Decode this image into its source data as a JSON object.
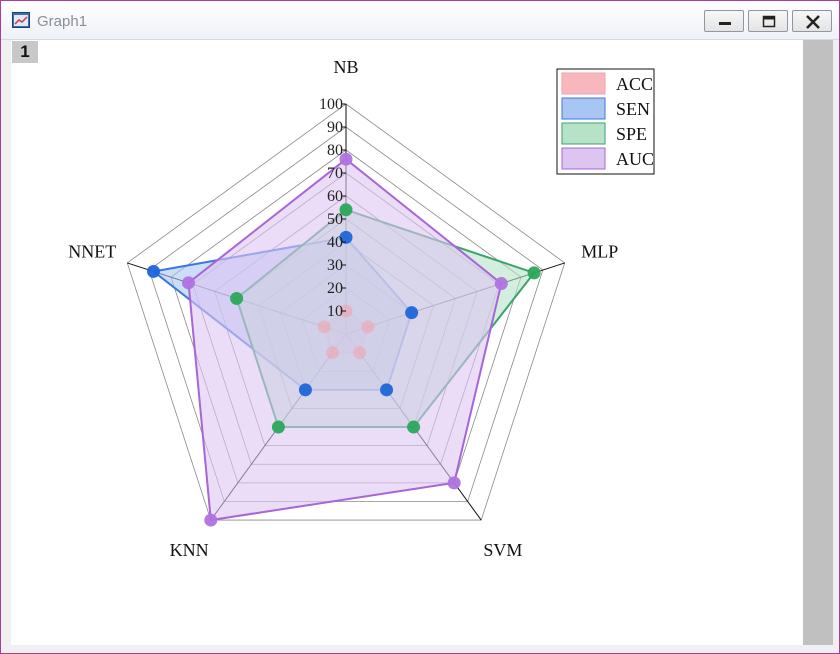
{
  "window": {
    "title": "Graph1",
    "layer_number": "1"
  },
  "chart_data": {
    "type": "radar",
    "axes": [
      "NB",
      "MLP",
      "SVM",
      "KNN",
      "NNET"
    ],
    "rlim": [
      0,
      100
    ],
    "ticks": [
      10,
      20,
      30,
      40,
      50,
      60,
      70,
      80,
      90,
      100
    ],
    "tick_labels": [
      "10",
      "20",
      "30",
      "40",
      "50",
      "60",
      "70",
      "80",
      "90",
      "100"
    ],
    "grid": true,
    "legend_position": "top-right",
    "series": [
      {
        "name": "ACC",
        "values": [
          10,
          10,
          10,
          10,
          10
        ],
        "color": "#f4a0a8",
        "fill": "#f6b8bd"
      },
      {
        "name": "SEN",
        "values": [
          42,
          30,
          30,
          30,
          88
        ],
        "color": "#3a78e0",
        "fill": "#a9c6f2",
        "point_color": "#1e66d8"
      },
      {
        "name": "SPE",
        "values": [
          54,
          86,
          50,
          50,
          50
        ],
        "color": "#3aa36a",
        "fill": "#b6e3c8",
        "point_color": "#2aa85a"
      },
      {
        "name": "AUC",
        "values": [
          76,
          71,
          80,
          100,
          72
        ],
        "color": "#a865d8",
        "fill": "#ddc5f2",
        "point_color": "#b072e0"
      }
    ]
  }
}
